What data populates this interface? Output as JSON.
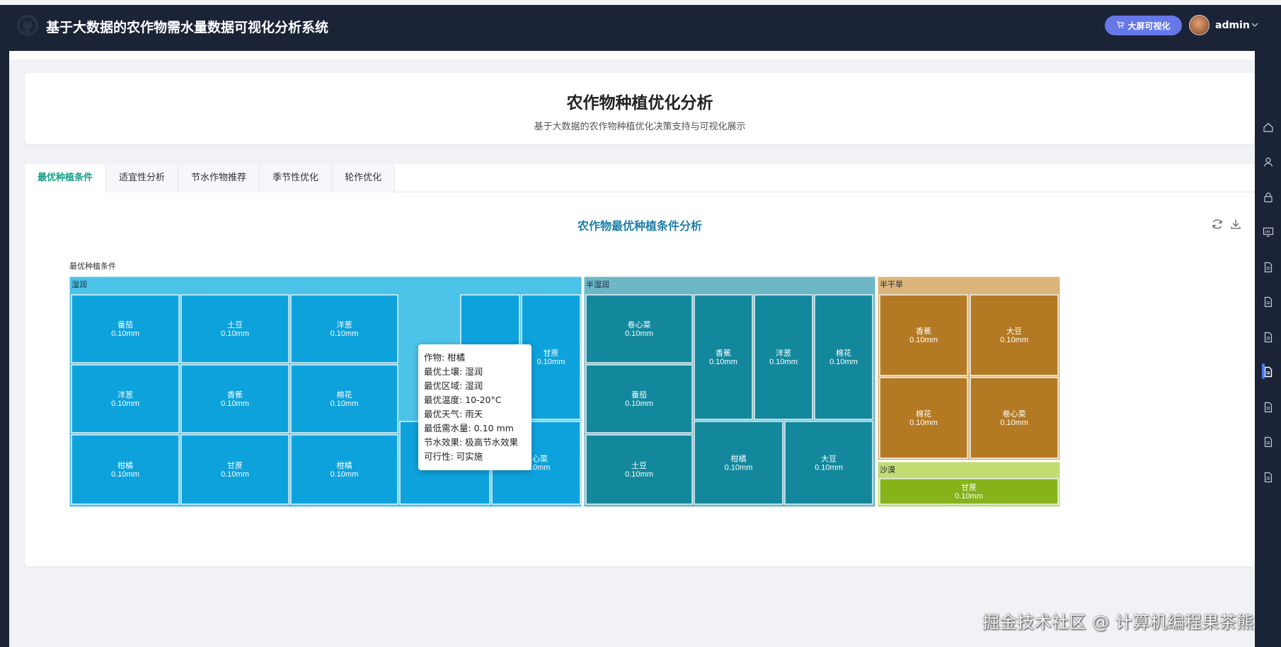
{
  "app": {
    "title": "基于大数据的农作物需水量数据可视化分析系统",
    "bigscreen_label": "大屏可视化",
    "username": "admin"
  },
  "page": {
    "title": "农作物种植优化分析",
    "subtitle": "基于大数据的农作物种植优化决策支持与可视化展示"
  },
  "tabs": [
    {
      "label": "最优种植条件",
      "active": true
    },
    {
      "label": "适宜性分析",
      "active": false
    },
    {
      "label": "节水作物推荐",
      "active": false
    },
    {
      "label": "季节性优化",
      "active": false
    },
    {
      "label": "轮作优化",
      "active": false
    }
  ],
  "chart": {
    "title": "农作物最优种植条件分析",
    "root_label": "最优种植条件"
  },
  "chart_data": {
    "type": "treemap",
    "title": "农作物最优种植条件分析",
    "root": "最优种植条件",
    "unit": "mm",
    "groups": [
      {
        "name": "湿润",
        "color": "#0ea2dc",
        "header_color": "#4cc3e8",
        "items": [
          {
            "name": "番茄",
            "value": 0.1
          },
          {
            "name": "土豆",
            "value": 0.1
          },
          {
            "name": "洋葱",
            "value": 0.1
          },
          {
            "name": "番茄",
            "value": 0.1
          },
          {
            "name": "甘蔗",
            "value": 0.1
          },
          {
            "name": "洋葱",
            "value": 0.1
          },
          {
            "name": "香蕉",
            "value": 0.1
          },
          {
            "name": "棉花",
            "value": 0.1
          },
          {
            "name": "柑橘",
            "value": 0.1
          },
          {
            "name": "甘蔗",
            "value": 0.1
          },
          {
            "name": "柑橘",
            "value": 0.1
          },
          {
            "name": "土豆",
            "value": 0.1
          },
          {
            "name": "卷心菜",
            "value": 0.1
          }
        ]
      },
      {
        "name": "半湿润",
        "color": "#13889d",
        "header_color": "#6db7c6",
        "items": [
          {
            "name": "卷心菜",
            "value": 0.1
          },
          {
            "name": "番茄",
            "value": 0.1
          },
          {
            "name": "土豆",
            "value": 0.1
          },
          {
            "name": "香蕉",
            "value": 0.1
          },
          {
            "name": "洋葱",
            "value": 0.1
          },
          {
            "name": "棉花",
            "value": 0.1
          },
          {
            "name": "柑橘",
            "value": 0.1
          },
          {
            "name": "大豆",
            "value": 0.1
          }
        ]
      },
      {
        "name": "半干旱",
        "color": "#b47a23",
        "header_color": "#dcb57c",
        "items": [
          {
            "name": "香蕉",
            "value": 0.1
          },
          {
            "name": "大豆",
            "value": 0.1
          },
          {
            "name": "棉花",
            "value": 0.1
          },
          {
            "name": "卷心菜",
            "value": 0.1
          }
        ]
      },
      {
        "name": "沙漠",
        "color": "#86b21a",
        "header_color": "#c4dc74",
        "items": [
          {
            "name": "甘蔗",
            "value": 0.1
          }
        ]
      }
    ]
  },
  "tooltip": {
    "crop": "作物: 柑橘",
    "soil": "最优土壤: 湿润",
    "region": "最优区域: 湿润",
    "temp": "最优温度: 10-20°C",
    "weather": "最优天气: 雨天",
    "water": "最低需水量: 0.10 mm",
    "effect": "节水效果: 极高节水效果",
    "feasibility": "可行性: 可实施"
  },
  "watermark": "掘金技术社区 @ 计算机编程果茶熊",
  "colors": {
    "header_bg": "#1b2336",
    "accent_tab": "#17a08a",
    "chart_title": "#1e7fa8",
    "bigscreen_btn": "#6677e8"
  }
}
